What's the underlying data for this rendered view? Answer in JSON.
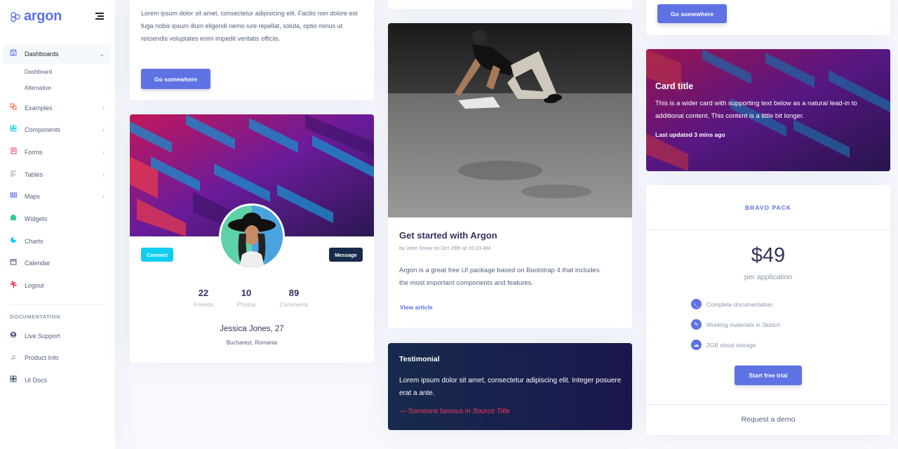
{
  "brand": {
    "name": "argon"
  },
  "sidebar": {
    "items": [
      {
        "label": "Dashboards",
        "icon": "shop-icon",
        "color": "#5e72e4"
      },
      {
        "label": "Examples",
        "icon": "ungroup-icon",
        "color": "#fb6340"
      },
      {
        "label": "Components",
        "icon": "ui-04-icon",
        "color": "#11cdef"
      },
      {
        "label": "Forms",
        "icon": "single-copy-icon",
        "color": "#f5365c"
      },
      {
        "label": "Tables",
        "icon": "align-left-icon",
        "color": "#8898aa"
      },
      {
        "label": "Maps",
        "icon": "map-big-icon",
        "color": "#5e72e4"
      },
      {
        "label": "Widgets",
        "icon": "archive-icon",
        "color": "#2dce89"
      },
      {
        "label": "Charts",
        "icon": "chart-pie-icon",
        "color": "#11cdef"
      },
      {
        "label": "Calendar",
        "icon": "calendar-icon",
        "color": "#525f7f"
      },
      {
        "label": "Logout",
        "icon": "user-run-icon",
        "color": "#f5365c"
      }
    ],
    "sub_items": [
      "Dashboard",
      "Alternative"
    ],
    "doc_heading": "DOCUMENTATION",
    "doc_items": [
      {
        "label": "Live Support",
        "icon": "circle-user-icon"
      },
      {
        "label": "Product Info",
        "icon": "music-icon"
      },
      {
        "label": "UI Docs",
        "icon": "components-icon"
      }
    ]
  },
  "col1": {
    "top_text": "Lorem ipsum dolor sit amet, consectetur adipisicing elit. Facilis non dolore est fuga nobis ipsum illum eligendi nemo iure repellat, soluta, optio minus ut reiciendis voluptates enim impedit veritatis officiis.",
    "top_button": "Go somewhere",
    "profile": {
      "connect": "Connect",
      "message": "Message",
      "stats": [
        {
          "num": "22",
          "label": "Friends"
        },
        {
          "num": "10",
          "label": "Photos"
        },
        {
          "num": "89",
          "label": "Comments"
        }
      ],
      "name": "Jessica Jones",
      "age": ", 27",
      "location": "Bucharest, Romania"
    }
  },
  "col2": {
    "article": {
      "title": "Get started with Argon",
      "meta": "by John Snow on Oct 29th at 10:23 AM",
      "text": "Argon is a great free UI package based on Bootstrap 4 that includes the most important components and features.",
      "link": "View article"
    },
    "testimonial": {
      "title": "Testimonial",
      "text": "Lorem ipsum dolor sit amet, consectetur adipiscing elit. Integer posuere erat a ante.",
      "foot_prefix": "— Someone famous in ",
      "foot_source": "Source Title"
    }
  },
  "col3": {
    "top_button": "Go somewhere",
    "image_card": {
      "title": "Card title",
      "text": "This is a wider card with supporting text below as a natural lead-in to additional content. This content is a little bit longer.",
      "updated": "Last updated 3 mins ago"
    },
    "pricing": {
      "pack": "BRAVO PACK",
      "price": "$49",
      "per": "per application",
      "features": [
        {
          "label": "Complete documentation",
          "icon": "terminal-icon"
        },
        {
          "label": "Working materials in Sketch",
          "icon": "pen-icon"
        },
        {
          "label": "2GB cloud storage",
          "icon": "hdd-icon"
        }
      ],
      "button": "Start free trial",
      "demo": "Request a demo"
    }
  },
  "colors": {
    "primary": "#5e72e4",
    "info": "#11cdef",
    "default": "#172b4d",
    "danger": "#f5365c"
  }
}
